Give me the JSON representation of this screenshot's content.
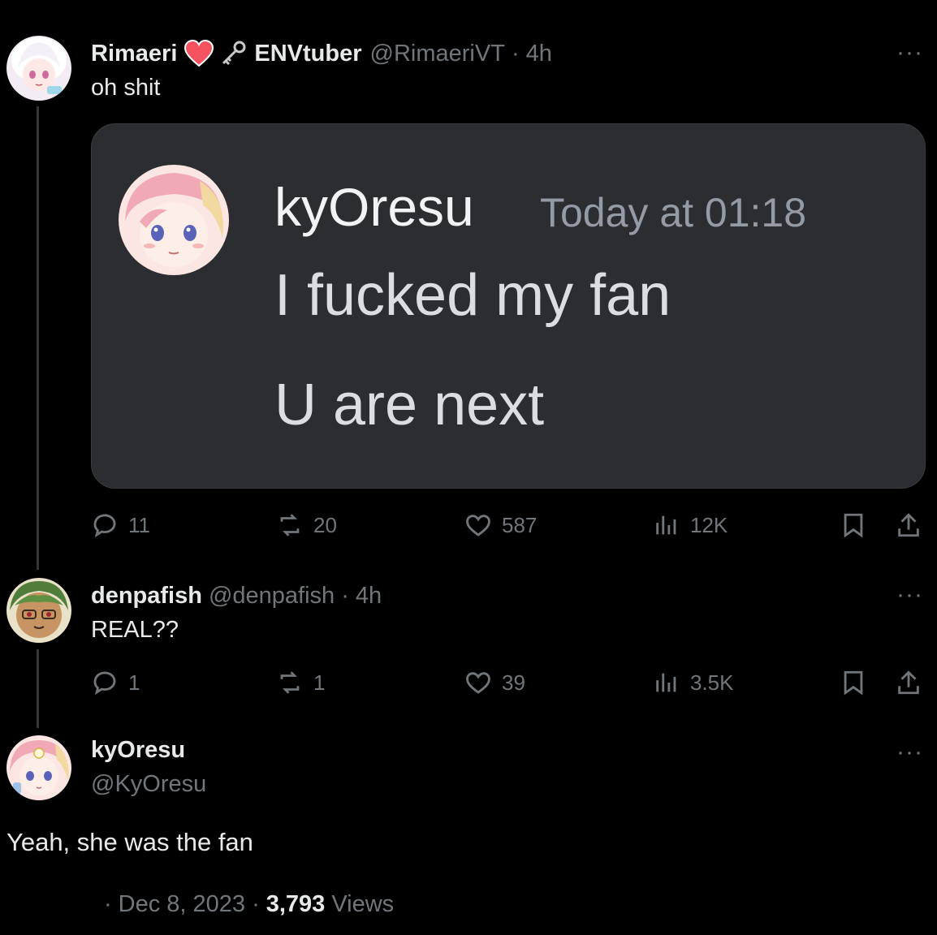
{
  "tweet1": {
    "display_name": "Rimaeri",
    "emoji_heart": "❤",
    "name_suffix": "ENVtuber",
    "handle": "@RimaeriVT",
    "time": "· 4h",
    "text": "oh shit",
    "more": "···",
    "embed": {
      "username": "kyOresu",
      "timestamp": "Today at 01:18",
      "line1": "I fucked my fan",
      "line2": "U are next"
    },
    "stats": {
      "replies": "11",
      "reposts": "20",
      "likes": "587",
      "views": "12K"
    }
  },
  "tweet2": {
    "display_name": "denpafish",
    "handle": "@denpafish",
    "time": "· 4h",
    "text": "REAL??",
    "more": "···",
    "stats": {
      "replies": "1",
      "reposts": "1",
      "likes": "39",
      "views": "3.5K"
    }
  },
  "tweet3": {
    "display_name": "kyOresu",
    "handle": "@KyOresu",
    "text": "Yeah, she was the fan",
    "more": "···",
    "meta_prefix": "·",
    "date": "Dec 8, 2023",
    "dot": "·",
    "view_count": "3,793",
    "views_label": "Views"
  },
  "colors": {
    "background": "#000000",
    "text_primary": "#e7e9ea",
    "text_muted": "#71767b",
    "embed_bg": "#2b2d31",
    "heart": "#f4525f"
  },
  "icons": [
    "reply-icon",
    "repost-icon",
    "like-icon",
    "views-icon",
    "bookmark-icon",
    "share-icon",
    "key-icon",
    "heart-emoji-icon"
  ]
}
